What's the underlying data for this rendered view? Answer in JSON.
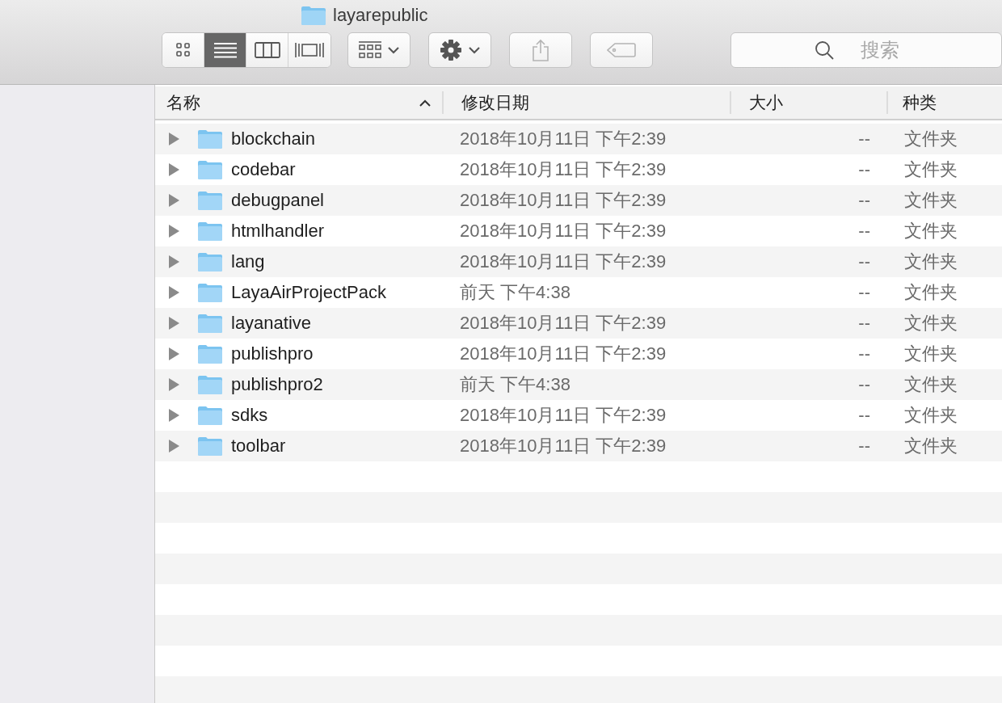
{
  "window": {
    "title": "layarepublic"
  },
  "toolbar": {
    "view_modes": [
      {
        "kind": "icons",
        "selected": false
      },
      {
        "kind": "list",
        "selected": true
      },
      {
        "kind": "columns",
        "selected": false
      },
      {
        "kind": "coverflow",
        "selected": false
      }
    ],
    "buttons": [
      {
        "kind": "arrange",
        "disabled": false
      },
      {
        "kind": "action",
        "disabled": false
      },
      {
        "kind": "share",
        "disabled": true
      },
      {
        "kind": "tags",
        "disabled": true
      }
    ],
    "search": {
      "placeholder": "搜索"
    }
  },
  "table": {
    "columns": [
      {
        "label": "名称",
        "sorted": true
      },
      {
        "label": "修改日期",
        "sorted": false
      },
      {
        "label": "大小",
        "sorted": false
      },
      {
        "label": "种类",
        "sorted": false
      }
    ],
    "rows": [
      {
        "name": "blockchain",
        "date": "2018年10月11日 下午2:39",
        "size": "--",
        "kind": "文件夹",
        "expanded": false
      },
      {
        "name": "codebar",
        "date": "2018年10月11日 下午2:39",
        "size": "--",
        "kind": "文件夹",
        "expanded": false
      },
      {
        "name": "debugpanel",
        "date": "2018年10月11日 下午2:39",
        "size": "--",
        "kind": "文件夹",
        "expanded": false
      },
      {
        "name": "htmlhandler",
        "date": "2018年10月11日 下午2:39",
        "size": "--",
        "kind": "文件夹",
        "expanded": false
      },
      {
        "name": "lang",
        "date": "2018年10月11日 下午2:39",
        "size": "--",
        "kind": "文件夹",
        "expanded": false
      },
      {
        "name": "LayaAirProjectPack",
        "date": "前天 下午4:38",
        "size": "--",
        "kind": "文件夹",
        "expanded": false
      },
      {
        "name": "layanative",
        "date": "2018年10月11日 下午2:39",
        "size": "--",
        "kind": "文件夹",
        "expanded": false
      },
      {
        "name": "publishpro",
        "date": "2018年10月11日 下午2:39",
        "size": "--",
        "kind": "文件夹",
        "expanded": false
      },
      {
        "name": "publishpro2",
        "date": "前天 下午4:38",
        "size": "--",
        "kind": "文件夹",
        "expanded": false
      },
      {
        "name": "sdks",
        "date": "2018年10月11日 下午2:39",
        "size": "--",
        "kind": "文件夹",
        "expanded": false
      },
      {
        "name": "toolbar",
        "date": "2018年10月11日 下午2:39",
        "size": "--",
        "kind": "文件夹",
        "expanded": false
      }
    ]
  }
}
